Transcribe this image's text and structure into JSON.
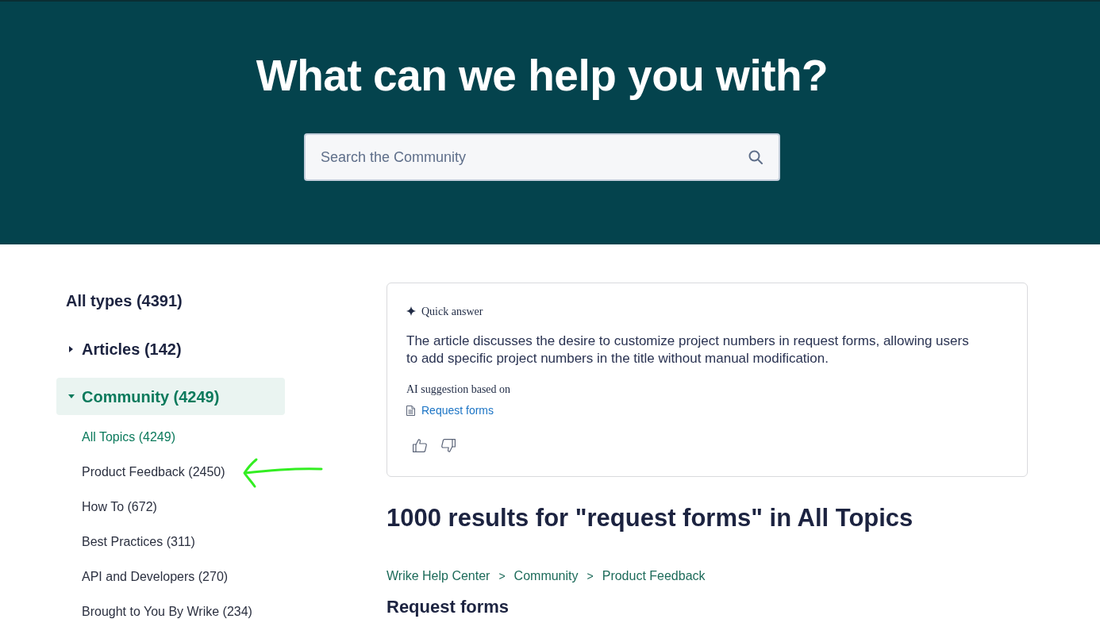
{
  "header": {
    "title": "What can we help you with?",
    "search": {
      "placeholder": "Search the Community"
    }
  },
  "sidebar": {
    "all_types": {
      "label": "All types (4391)",
      "selected": false
    },
    "groups": [
      {
        "label": "Articles (142)",
        "expanded": false,
        "selected": false
      },
      {
        "label": "Community (4249)",
        "expanded": true,
        "selected": true,
        "children": [
          {
            "label": "All Topics (4249)",
            "selected": true
          },
          {
            "label": "Product Feedback (2450)",
            "selected": false
          },
          {
            "label": "How To (672)",
            "selected": false
          },
          {
            "label": "Best Practices (311)",
            "selected": false
          },
          {
            "label": "API and Developers (270)",
            "selected": false
          },
          {
            "label": "Brought to You By Wrike (234)",
            "selected": false
          }
        ]
      }
    ]
  },
  "quick_answer": {
    "title": "Quick answer",
    "summary": "The article discusses the desire to customize project numbers in request forms, allowing users to add specific project numbers in the title without manual modification.",
    "source_label": "AI suggestion based on",
    "source_link": "Request forms"
  },
  "results": {
    "heading": "1000 results for \"request forms\" in All Topics",
    "items": [
      {
        "breadcrumb": [
          {
            "kind": "link",
            "text": "Wrike Help Center"
          },
          {
            "kind": "separator",
            "text": ">"
          },
          {
            "kind": "link",
            "text": "Community"
          },
          {
            "kind": "separator",
            "text": ">"
          },
          {
            "kind": "link",
            "text": "Product Feedback"
          }
        ],
        "title": "Request forms"
      }
    ]
  },
  "annotations": [
    {
      "kind": "arrow"
    }
  ]
}
